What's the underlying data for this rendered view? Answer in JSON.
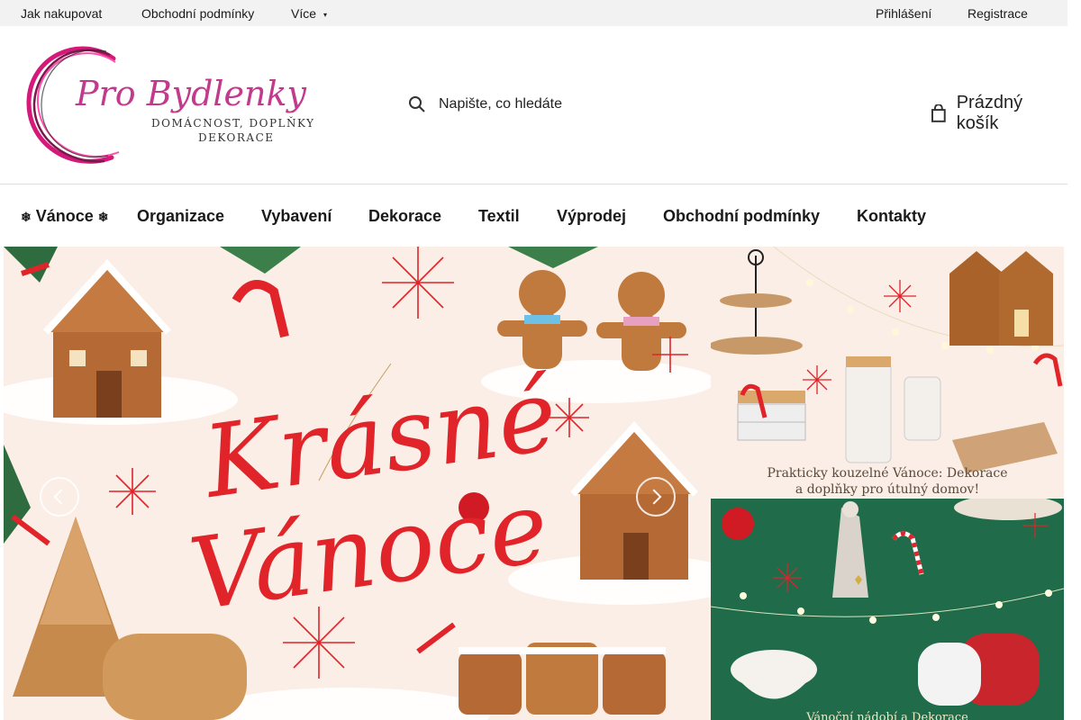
{
  "topbar": {
    "how_to_buy": "Jak nakupovat",
    "terms": "Obchodní podmínky",
    "more": "Více",
    "login": "Přihlášení",
    "register": "Registrace"
  },
  "header": {
    "logo_title": "Pro Bydlenky",
    "logo_sub1": "DOMÁCNOST, DOPLŇKY &",
    "logo_sub2": "DEKORACE",
    "search_placeholder": "Napište, co hledáte",
    "cart_label": "Prázdný košík"
  },
  "nav": {
    "items": [
      {
        "label": "Vánoce",
        "icon_left": "snowflake-icon",
        "icon_right": "snowflake-icon"
      },
      {
        "label": "Organizace"
      },
      {
        "label": "Vybavení"
      },
      {
        "label": "Dekorace"
      },
      {
        "label": "Textil"
      },
      {
        "label": "Výprodej"
      },
      {
        "label": "Obchodní podmínky"
      },
      {
        "label": "Kontakty"
      }
    ]
  },
  "banners": {
    "main_line1": "Krásné",
    "main_line2": "Vánoce",
    "top_caption_1": "Prakticky kouzelné Vánoce: Dekorace",
    "top_caption_2": "a doplňky pro útulný domov!",
    "bottom_caption": "Vánoční nádobí a Dekorace"
  },
  "colors": {
    "brand_pink": "#e0248a",
    "banner_red": "#e0242a",
    "banner_bg": "#fbeee6",
    "banner_green": "#1f6b4a"
  }
}
